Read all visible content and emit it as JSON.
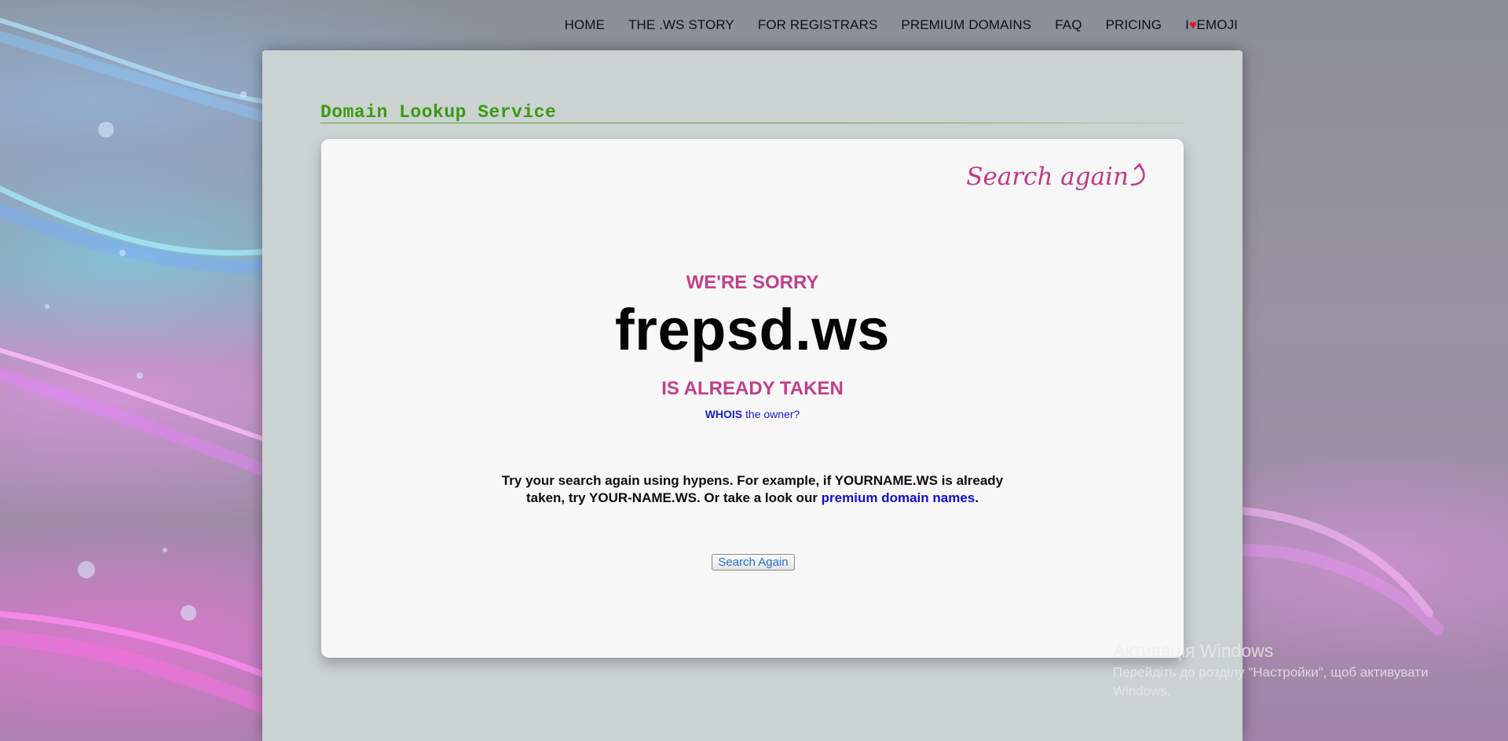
{
  "nav": {
    "items": [
      {
        "label": "HOME"
      },
      {
        "label": "THE .WS STORY"
      },
      {
        "label": "FOR REGISTRARS"
      },
      {
        "label": "PREMIUM DOMAINS"
      },
      {
        "label": "FAQ"
      },
      {
        "label": "PRICING"
      }
    ],
    "emoji_prefix": "I",
    "emoji_heart": "♥",
    "emoji_suffix": "EMOJI"
  },
  "section": {
    "title": "Domain Lookup Service"
  },
  "result": {
    "search_again_link": "Search again",
    "sorry": "WE'RE SORRY",
    "domain": "frepsd.ws",
    "status": "IS ALREADY TAKEN",
    "whois_bold": "WHOIS",
    "whois_rest": " the owner?",
    "hint_text": "Try your search again using hypens. For example, if YOURNAME.WS is already taken, try YOUR-NAME.WS. Or take a look our ",
    "hint_link": "premium domain names",
    "hint_end": ".",
    "button_label": "Search Again"
  },
  "watermark": {
    "title": "Активація Windows",
    "subtitle": "Перейдіть до розділу \"Настройки\", щоб активувати Windows."
  },
  "colors": {
    "accent_pink": "#c0408a",
    "title_green": "#3a9a10",
    "link_blue": "#1010cc",
    "heart_red": "#e0101a"
  }
}
